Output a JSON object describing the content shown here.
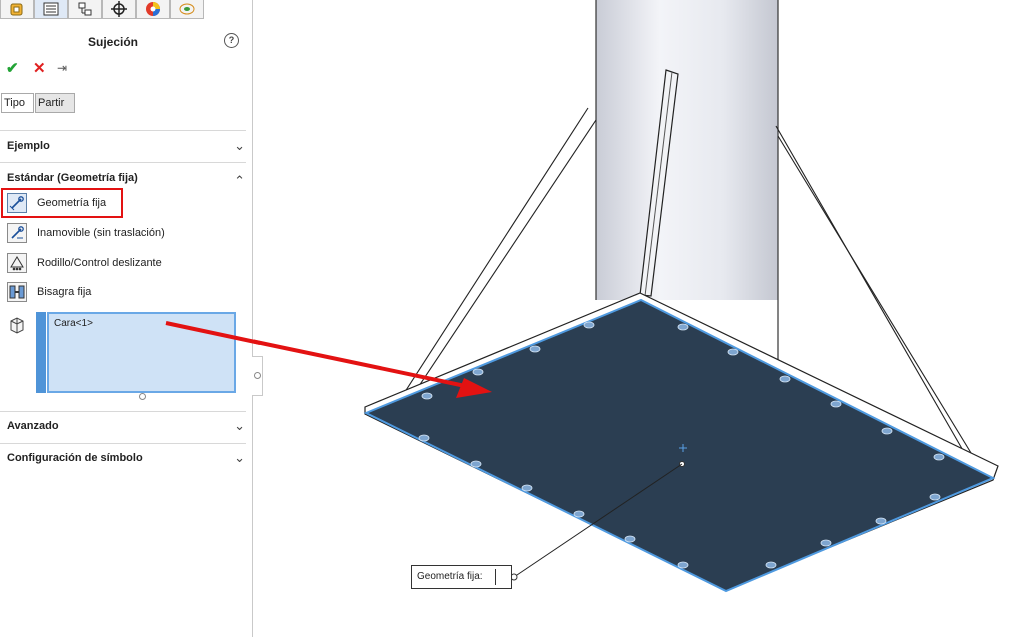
{
  "panel": {
    "title": "Sujeción",
    "tabs": [
      "Tipo",
      "Partir"
    ],
    "sections": {
      "example": "Ejemplo",
      "standard": "Estándar (Geometría fija)",
      "advanced": "Avanzado",
      "symbol": "Configuración de símbolo"
    },
    "options": [
      {
        "label": "Geometría fija",
        "icon": "fixed-geometry-icon"
      },
      {
        "label": "Inamovible (sin traslación)",
        "icon": "immovable-icon"
      },
      {
        "label": "Rodillo/Control deslizante",
        "icon": "roller-slider-icon"
      },
      {
        "label": "Bisagra fija",
        "icon": "fixed-hinge-icon"
      }
    ],
    "selection": [
      "Cara<1>"
    ]
  },
  "viewport": {
    "callout_label": "Geometría fija:"
  },
  "colors": {
    "plate": "#2b3e52",
    "face_edge": "#4f9ae0",
    "highlight": "#e31212",
    "accept": "#22a335",
    "cancel": "#e02020"
  }
}
